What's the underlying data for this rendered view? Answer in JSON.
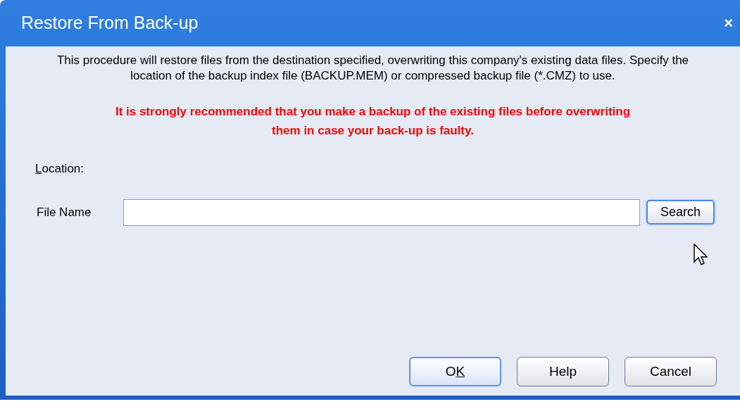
{
  "window": {
    "title": "Restore From Back-up",
    "close": "×"
  },
  "description": "This procedure will restore files from the destination specified, overwriting this company's existing data files. Specify the location of the backup index file (BACKUP.MEM) or compressed backup file (*.CMZ) to use.",
  "warning": "It is strongly recommended that you make a backup of the existing files before overwriting them in case your back-up is faulty.",
  "location_label": {
    "access_key": "L",
    "after_key": "ocation:"
  },
  "file_name": {
    "label": "File Name",
    "search_button": {
      "label": "Search",
      "highlighted": true
    }
  },
  "buttons": [
    {
      "before_key": "O",
      "access_key": "K",
      "highlighted": true
    },
    {
      "label": "Help",
      "highlighted": false
    },
    {
      "label": "Cancel",
      "highlighted": false
    }
  ]
}
